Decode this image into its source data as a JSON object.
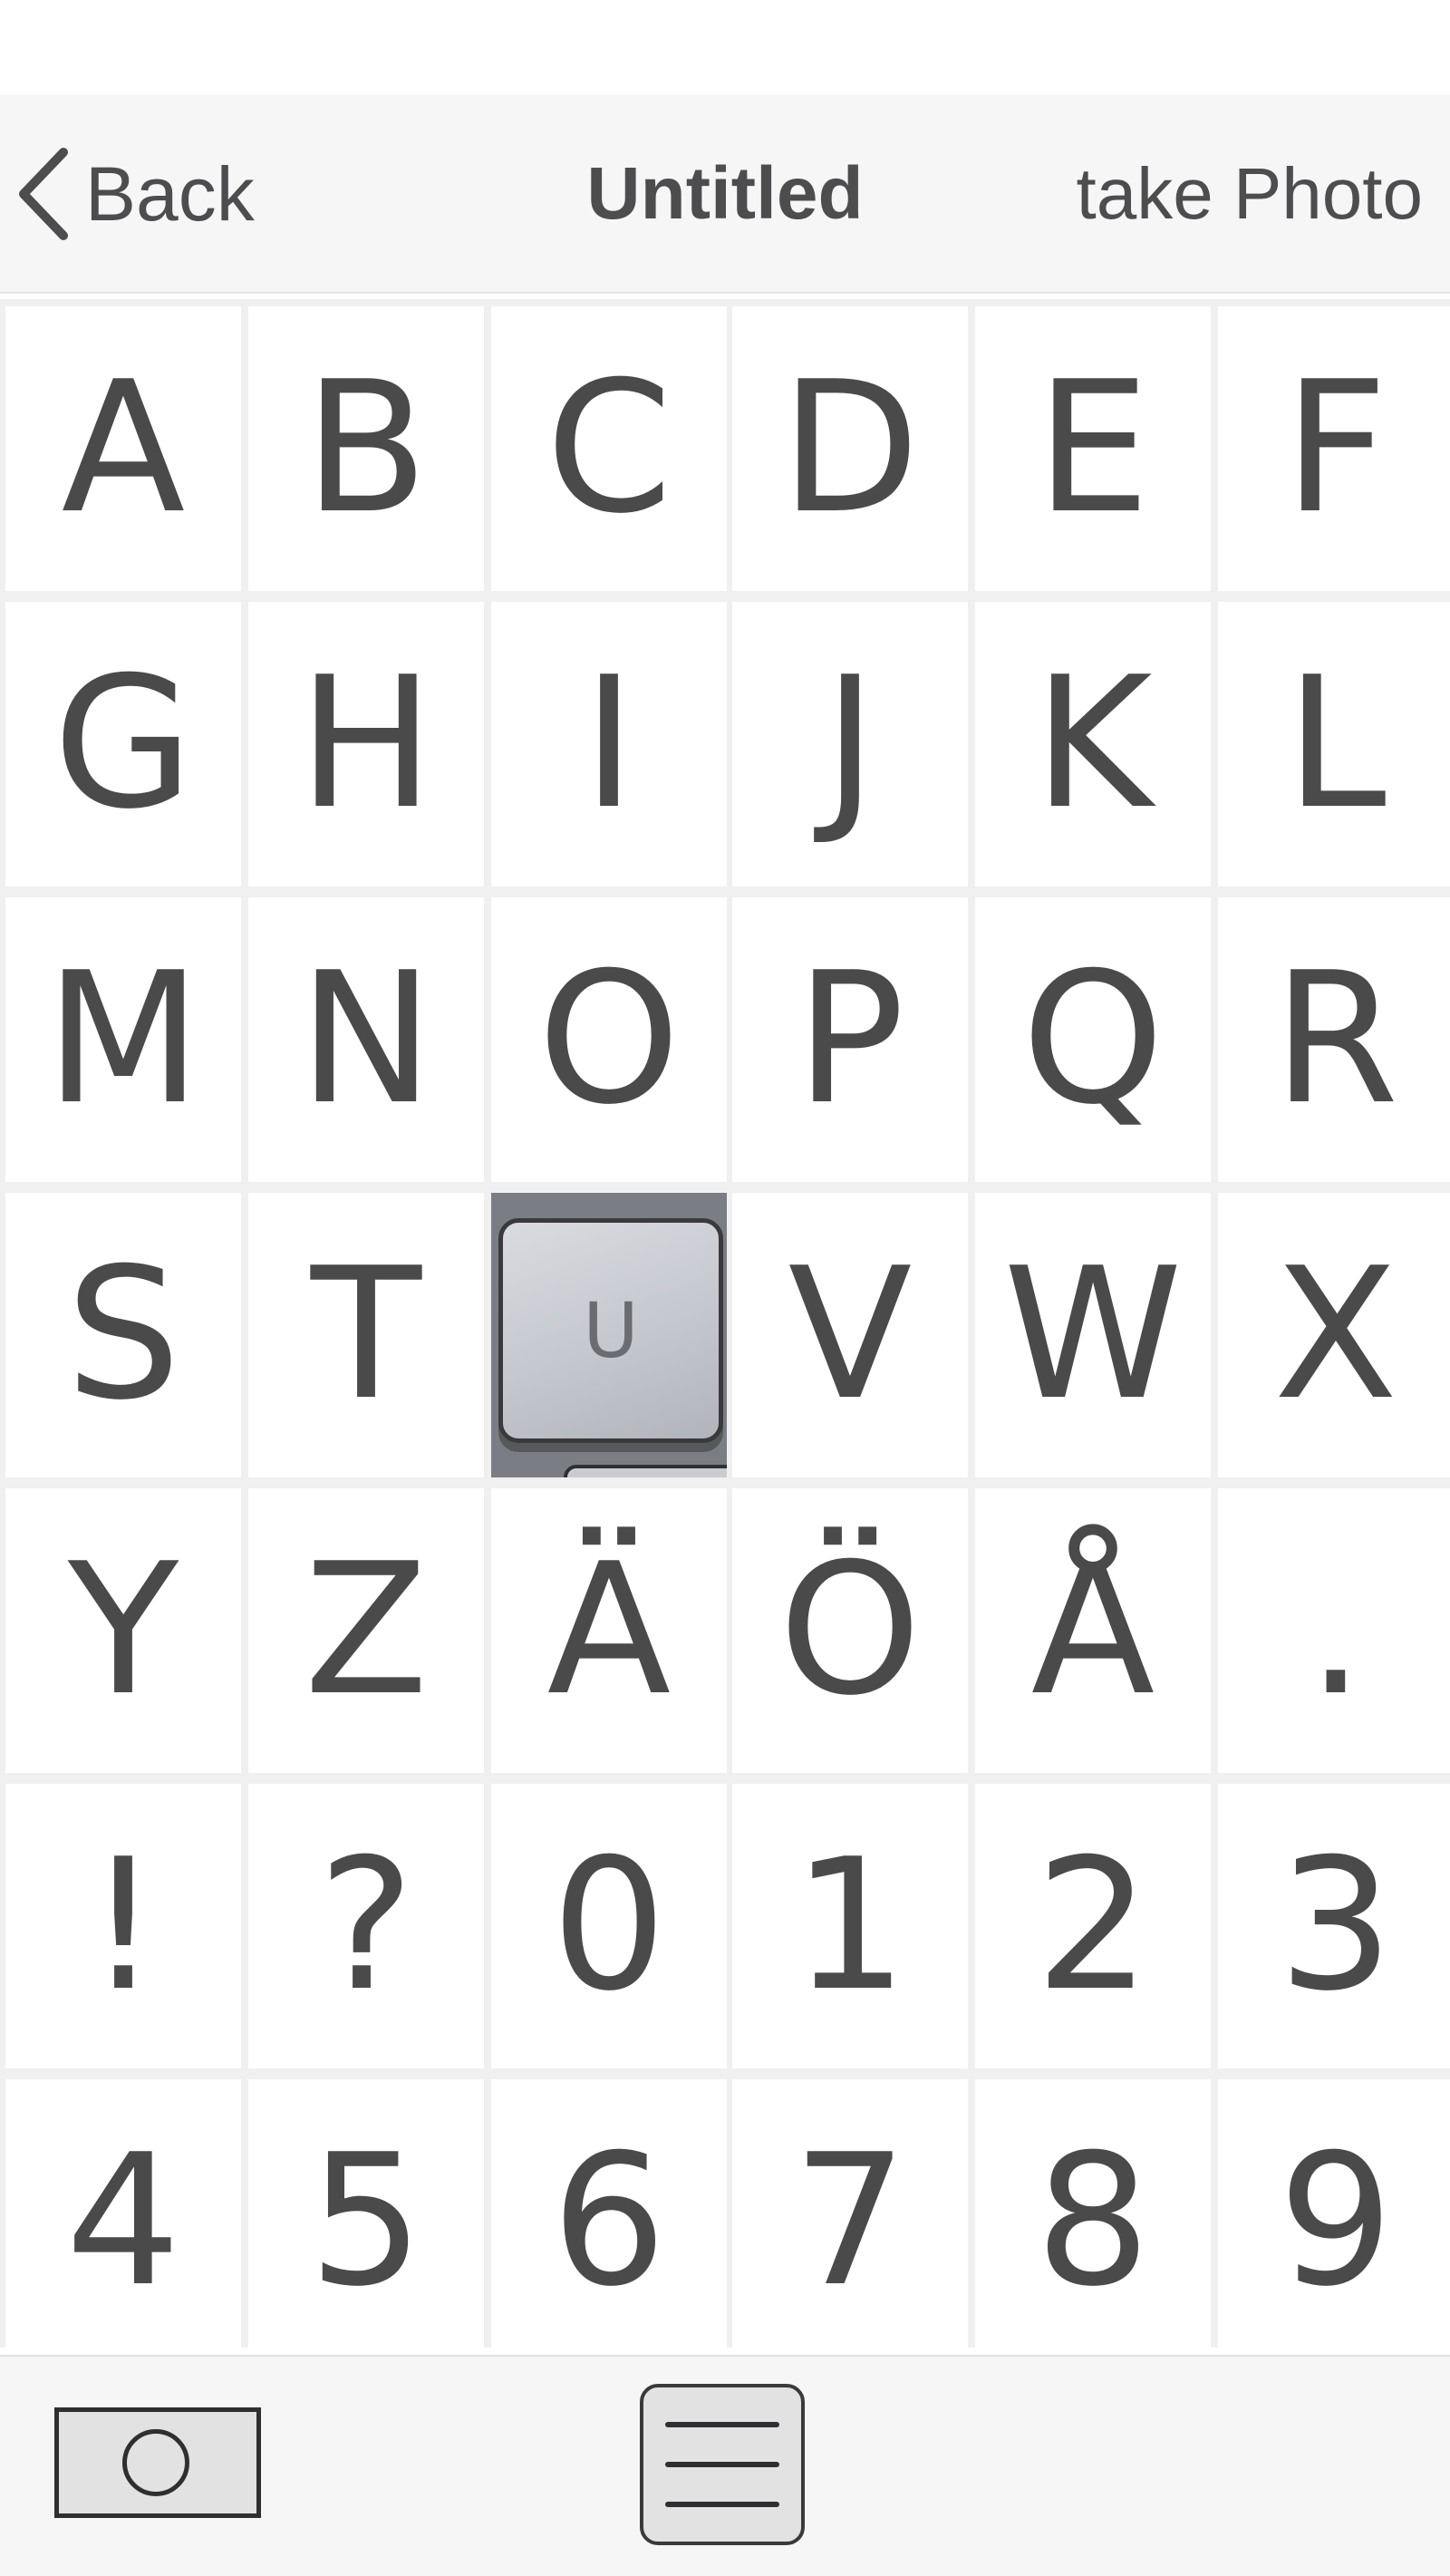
{
  "nav": {
    "back_label": "Back",
    "title": "Untitled",
    "right_action": "take Photo"
  },
  "grid": {
    "rows": [
      [
        "A",
        "B",
        "C",
        "D",
        "E",
        "F"
      ],
      [
        "G",
        "H",
        "I",
        "J",
        "K",
        "L"
      ],
      [
        "M",
        "N",
        "O",
        "P",
        "Q",
        "R"
      ],
      [
        "S",
        "T",
        "U",
        "V",
        "W",
        "X"
      ],
      [
        "Y",
        "Z",
        "Ä",
        "Ö",
        "Å",
        "."
      ],
      [
        "!",
        "?",
        "0",
        "1",
        "2",
        "3"
      ],
      [
        "4",
        "5",
        "6",
        "7",
        "8",
        "9"
      ]
    ],
    "photo_cell": {
      "key_label": "U"
    }
  },
  "toolbar": {
    "camera_icon": "camera-icon",
    "menu_icon": "menu-icon"
  },
  "colors": {
    "glyph": "#4a4a4a",
    "bar_bg": "#f6f6f6",
    "grid_gap": "#f0f0f0"
  }
}
